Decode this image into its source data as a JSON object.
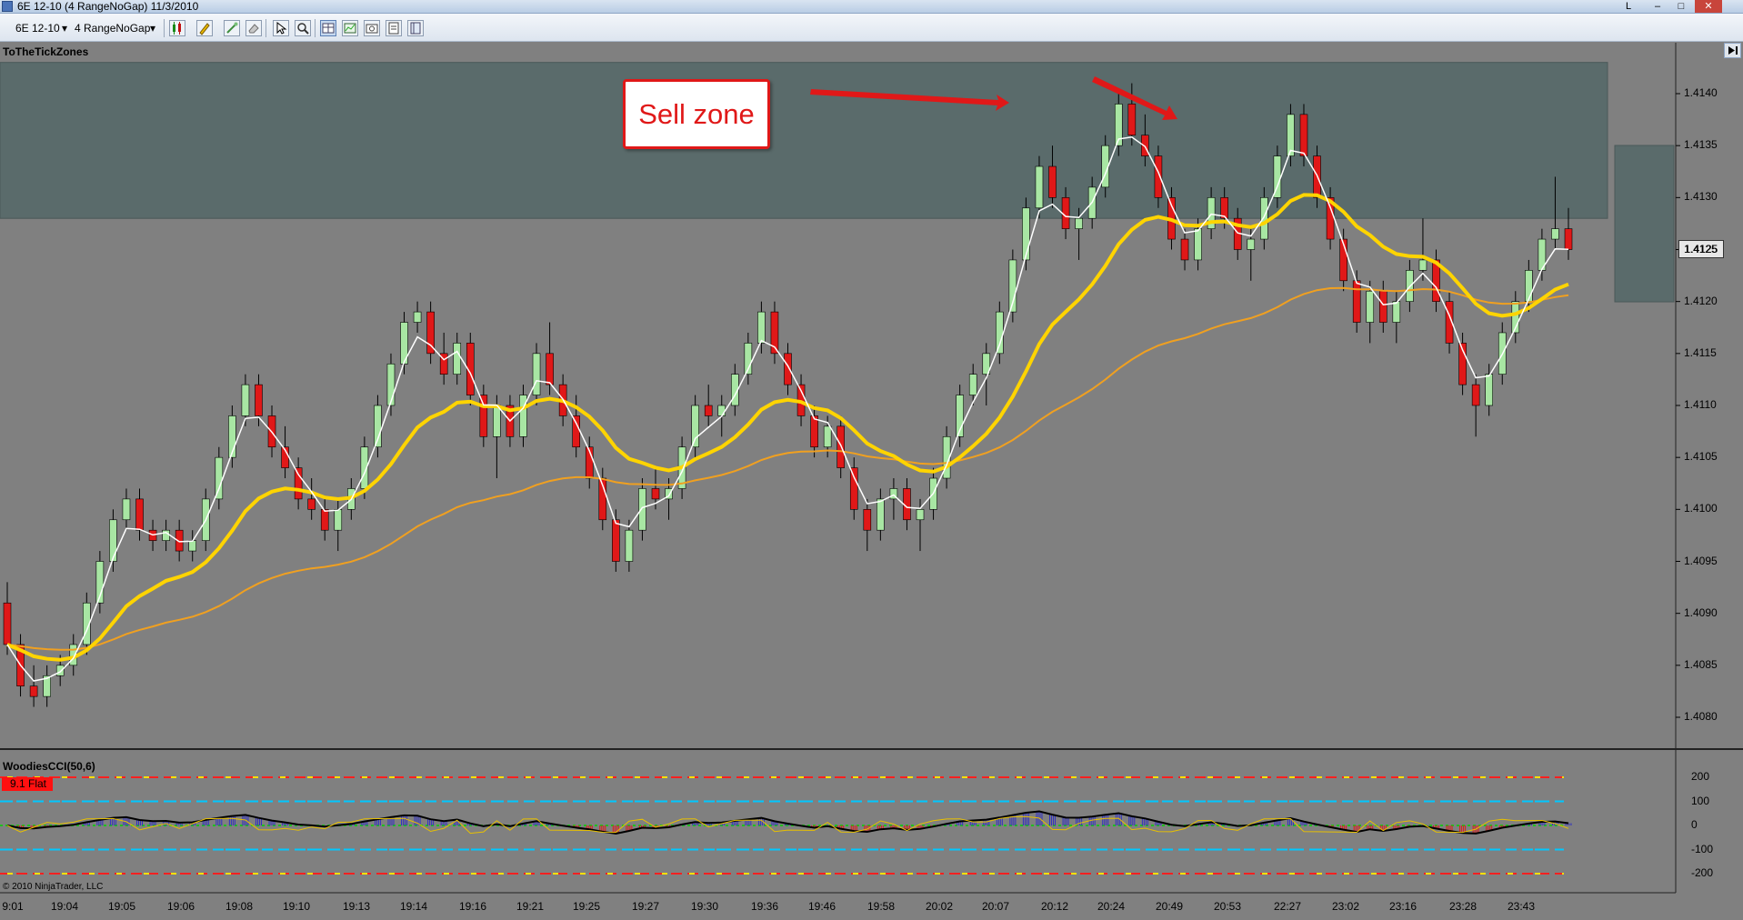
{
  "window": {
    "title": "6E 12-10 (4 RangeNoGap)  11/3/2010",
    "btn_help": "L",
    "btn_minimize": "–",
    "btn_maximize": "□",
    "btn_close": "✕"
  },
  "toolbar": {
    "instrument": "6E 12-10",
    "period": "4 RangeNoGap",
    "dropdown_arrow": "▾"
  },
  "chart": {
    "panel_title": "ToTheTickZones",
    "annotation": "Sell zone",
    "current_price": "1.4125",
    "copyright": "© 2010 NinjaTrader, LLC",
    "indicator_title": "WoodiesCCI(50,6)",
    "indicator_badge": "9.1 Flat",
    "price_labels": [
      "1.4140",
      "1.4135",
      "1.4130",
      "1.4125",
      "1.4120",
      "1.4115",
      "1.4110",
      "1.4105",
      "1.4100",
      "1.4095",
      "1.4090",
      "1.4085",
      "1.4080"
    ],
    "cci_labels": [
      "200",
      "100",
      "0",
      "-100",
      "-200"
    ],
    "time_labels": [
      "9:01",
      "19:04",
      "19:05",
      "19:06",
      "19:08",
      "19:10",
      "19:13",
      "19:14",
      "19:16",
      "19:21",
      "19:25",
      "19:27",
      "19:30",
      "19:36",
      "19:46",
      "19:58",
      "20:02",
      "20:07",
      "20:12",
      "20:24",
      "20:49",
      "20:53",
      "22:27",
      "23:02",
      "23:16",
      "23:28",
      "23:43"
    ],
    "colors": {
      "background": "#808080",
      "zone": "#5a6b6b",
      "up_bar": "#a8e6a3",
      "down_bar": "#e01818",
      "ema_fast": "#ffffff",
      "ema_mid": "#ffd400",
      "ema_slow": "#f0a020",
      "cci_up": "#3030c0",
      "cci_down": "#e01818"
    }
  },
  "chart_data": {
    "type": "candlestick",
    "instrument": "6E 12-10",
    "y_range": [
      1.4078,
      1.4143
    ],
    "time_labels": [
      "9:01",
      "19:04",
      "19:05",
      "19:06",
      "19:08",
      "19:10",
      "19:13",
      "19:14",
      "19:16",
      "19:21",
      "19:25",
      "19:27",
      "19:30",
      "19:36",
      "19:46",
      "19:58",
      "20:02",
      "20:07",
      "20:12",
      "20:24",
      "20:49",
      "20:53",
      "22:27",
      "23:02",
      "23:16",
      "23:28",
      "23:43"
    ],
    "zone": [
      1.4128,
      1.4143
    ],
    "bars": [
      [
        1.4091,
        1.4093,
        1.4086,
        1.4087
      ],
      [
        1.4087,
        1.4088,
        1.4082,
        1.4083
      ],
      [
        1.4083,
        1.4085,
        1.4081,
        1.4082
      ],
      [
        1.4082,
        1.4085,
        1.4081,
        1.4084
      ],
      [
        1.4084,
        1.4086,
        1.4083,
        1.4085
      ],
      [
        1.4085,
        1.4088,
        1.4084,
        1.4087
      ],
      [
        1.4087,
        1.4092,
        1.4086,
        1.4091
      ],
      [
        1.4091,
        1.4096,
        1.409,
        1.4095
      ],
      [
        1.4095,
        1.41,
        1.4094,
        1.4099
      ],
      [
        1.4099,
        1.4102,
        1.4098,
        1.4101
      ],
      [
        1.4101,
        1.4102,
        1.4097,
        1.4098
      ],
      [
        1.4098,
        1.4099,
        1.4096,
        1.4097
      ],
      [
        1.4097,
        1.4099,
        1.4096,
        1.4098
      ],
      [
        1.4098,
        1.4099,
        1.4095,
        1.4096
      ],
      [
        1.4096,
        1.4098,
        1.4095,
        1.4097
      ],
      [
        1.4097,
        1.4102,
        1.4096,
        1.4101
      ],
      [
        1.4101,
        1.4106,
        1.41,
        1.4105
      ],
      [
        1.4105,
        1.411,
        1.4104,
        1.4109
      ],
      [
        1.4109,
        1.4113,
        1.4108,
        1.4112
      ],
      [
        1.4112,
        1.4113,
        1.4108,
        1.4109
      ],
      [
        1.4109,
        1.411,
        1.4105,
        1.4106
      ],
      [
        1.4106,
        1.4108,
        1.4103,
        1.4104
      ],
      [
        1.4104,
        1.4105,
        1.41,
        1.4101
      ],
      [
        1.4101,
        1.4103,
        1.4099,
        1.41
      ],
      [
        1.41,
        1.4101,
        1.4097,
        1.4098
      ],
      [
        1.4098,
        1.4101,
        1.4096,
        1.41
      ],
      [
        1.41,
        1.4103,
        1.4099,
        1.4102
      ],
      [
        1.4102,
        1.4107,
        1.4101,
        1.4106
      ],
      [
        1.4106,
        1.4111,
        1.4105,
        1.411
      ],
      [
        1.411,
        1.4115,
        1.4109,
        1.4114
      ],
      [
        1.4114,
        1.4119,
        1.4113,
        1.4118
      ],
      [
        1.4118,
        1.412,
        1.4117,
        1.4119
      ],
      [
        1.4119,
        1.412,
        1.4114,
        1.4115
      ],
      [
        1.4115,
        1.4117,
        1.4112,
        1.4113
      ],
      [
        1.4113,
        1.4117,
        1.4112,
        1.4116
      ],
      [
        1.4116,
        1.4117,
        1.411,
        1.4111
      ],
      [
        1.4111,
        1.4112,
        1.4106,
        1.4107
      ],
      [
        1.4107,
        1.4111,
        1.4103,
        1.411
      ],
      [
        1.411,
        1.4111,
        1.4106,
        1.4107
      ],
      [
        1.4107,
        1.4112,
        1.4106,
        1.4111
      ],
      [
        1.4111,
        1.4116,
        1.411,
        1.4115
      ],
      [
        1.4115,
        1.4118,
        1.4111,
        1.4112
      ],
      [
        1.4112,
        1.4113,
        1.4108,
        1.4109
      ],
      [
        1.4109,
        1.4111,
        1.4105,
        1.4106
      ],
      [
        1.4106,
        1.4107,
        1.4102,
        1.4103
      ],
      [
        1.4103,
        1.4104,
        1.4098,
        1.4099
      ],
      [
        1.4099,
        1.41,
        1.4094,
        1.4095
      ],
      [
        1.4095,
        1.4099,
        1.4094,
        1.4098
      ],
      [
        1.4098,
        1.4103,
        1.4097,
        1.4102
      ],
      [
        1.4102,
        1.4104,
        1.41,
        1.4101
      ],
      [
        1.4101,
        1.4103,
        1.4099,
        1.4102
      ],
      [
        1.4102,
        1.4107,
        1.4101,
        1.4106
      ],
      [
        1.4106,
        1.4111,
        1.4105,
        1.411
      ],
      [
        1.411,
        1.4112,
        1.4108,
        1.4109
      ],
      [
        1.4109,
        1.4111,
        1.4107,
        1.411
      ],
      [
        1.411,
        1.4114,
        1.4109,
        1.4113
      ],
      [
        1.4113,
        1.4117,
        1.4112,
        1.4116
      ],
      [
        1.4116,
        1.412,
        1.4115,
        1.4119
      ],
      [
        1.4119,
        1.412,
        1.4114,
        1.4115
      ],
      [
        1.4115,
        1.4116,
        1.4111,
        1.4112
      ],
      [
        1.4112,
        1.4113,
        1.4108,
        1.4109
      ],
      [
        1.4109,
        1.411,
        1.4105,
        1.4106
      ],
      [
        1.4106,
        1.4109,
        1.4105,
        1.4108
      ],
      [
        1.4108,
        1.4109,
        1.4103,
        1.4104
      ],
      [
        1.4104,
        1.4105,
        1.4099,
        1.41
      ],
      [
        1.41,
        1.4101,
        1.4096,
        1.4098
      ],
      [
        1.4098,
        1.4102,
        1.4097,
        1.4101
      ],
      [
        1.4101,
        1.4103,
        1.4099,
        1.4102
      ],
      [
        1.4102,
        1.4103,
        1.4098,
        1.4099
      ],
      [
        1.4099,
        1.4101,
        1.4096,
        1.41
      ],
      [
        1.41,
        1.4104,
        1.4099,
        1.4103
      ],
      [
        1.4103,
        1.4108,
        1.4102,
        1.4107
      ],
      [
        1.4107,
        1.4112,
        1.4106,
        1.4111
      ],
      [
        1.4111,
        1.4114,
        1.411,
        1.4113
      ],
      [
        1.4113,
        1.4116,
        1.411,
        1.4115
      ],
      [
        1.4115,
        1.412,
        1.4114,
        1.4119
      ],
      [
        1.4119,
        1.4125,
        1.4118,
        1.4124
      ],
      [
        1.4124,
        1.413,
        1.4123,
        1.4129
      ],
      [
        1.4129,
        1.4134,
        1.4128,
        1.4133
      ],
      [
        1.4133,
        1.4135,
        1.4129,
        1.413
      ],
      [
        1.413,
        1.4131,
        1.4126,
        1.4127
      ],
      [
        1.4127,
        1.4129,
        1.4124,
        1.4128
      ],
      [
        1.4128,
        1.4132,
        1.4127,
        1.4131
      ],
      [
        1.4131,
        1.4136,
        1.413,
        1.4135
      ],
      [
        1.4135,
        1.414,
        1.4134,
        1.4139
      ],
      [
        1.4139,
        1.4141,
        1.4135,
        1.4136
      ],
      [
        1.4136,
        1.4138,
        1.4133,
        1.4134
      ],
      [
        1.4134,
        1.4135,
        1.4129,
        1.413
      ],
      [
        1.413,
        1.4131,
        1.4125,
        1.4126
      ],
      [
        1.4126,
        1.4127,
        1.4123,
        1.4124
      ],
      [
        1.4124,
        1.4128,
        1.4123,
        1.4127
      ],
      [
        1.4127,
        1.4131,
        1.4126,
        1.413
      ],
      [
        1.413,
        1.4131,
        1.4127,
        1.4128
      ],
      [
        1.4128,
        1.4129,
        1.4124,
        1.4125
      ],
      [
        1.4125,
        1.4127,
        1.4122,
        1.4126
      ],
      [
        1.4126,
        1.4131,
        1.4125,
        1.413
      ],
      [
        1.413,
        1.4135,
        1.4129,
        1.4134
      ],
      [
        1.4134,
        1.4139,
        1.4133,
        1.4138
      ],
      [
        1.4138,
        1.4139,
        1.4133,
        1.4134
      ],
      [
        1.4134,
        1.4135,
        1.4129,
        1.413
      ],
      [
        1.413,
        1.4131,
        1.4125,
        1.4126
      ],
      [
        1.4126,
        1.4127,
        1.4121,
        1.4122
      ],
      [
        1.4122,
        1.4123,
        1.4117,
        1.4118
      ],
      [
        1.4118,
        1.4122,
        1.4116,
        1.4121
      ],
      [
        1.4121,
        1.4122,
        1.4117,
        1.4118
      ],
      [
        1.4118,
        1.4121,
        1.4116,
        1.412
      ],
      [
        1.412,
        1.4124,
        1.4119,
        1.4123
      ],
      [
        1.4123,
        1.4128,
        1.4122,
        1.4124
      ],
      [
        1.4124,
        1.4125,
        1.4119,
        1.412
      ],
      [
        1.412,
        1.4121,
        1.4115,
        1.4116
      ],
      [
        1.4116,
        1.4117,
        1.4111,
        1.4112
      ],
      [
        1.4112,
        1.4113,
        1.4107,
        1.411
      ],
      [
        1.411,
        1.4114,
        1.4109,
        1.4113
      ],
      [
        1.4113,
        1.4118,
        1.4112,
        1.4117
      ],
      [
        1.4117,
        1.4121,
        1.4116,
        1.412
      ],
      [
        1.412,
        1.4124,
        1.4119,
        1.4123
      ],
      [
        1.4123,
        1.4127,
        1.4122,
        1.4126
      ],
      [
        1.4126,
        1.4132,
        1.4125,
        1.4127
      ],
      [
        1.4127,
        1.4129,
        1.4124,
        1.4125
      ]
    ]
  }
}
